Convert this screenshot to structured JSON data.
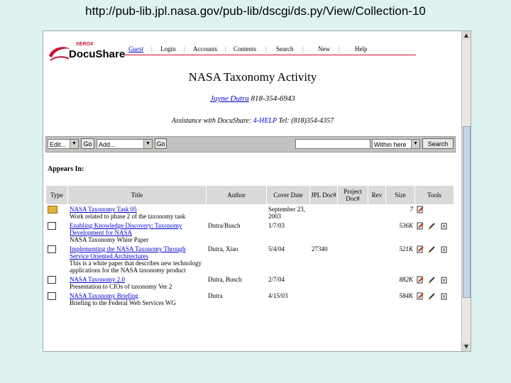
{
  "address_bar": {
    "url": "http://pub-lib.jpl.nasa.gov/pub-lib/dscgi/ds.py/View/Collection-10"
  },
  "logo": {
    "brand": "XEROX",
    "product": "DocuShare"
  },
  "nav": {
    "items": [
      "Guest",
      "Login",
      "Accounts",
      "Contents",
      "Search",
      "New",
      "Help"
    ]
  },
  "page": {
    "title": "NASA Taxonomy Activity",
    "contact_name": "Jayne Dutra",
    "contact_phone": "818-354-6943",
    "assist_label": "Assistance with DocuShare:",
    "assist_link": "4-HELP",
    "assist_tel": "Tel: (818)354-4357",
    "appears_in": "Appears In:"
  },
  "toolbar": {
    "edit_select": "Edit...",
    "go1": "Go",
    "add_select": "Add...",
    "go2": "Go",
    "scope_select": "Within here",
    "search_button": "Search"
  },
  "table": {
    "headers": [
      "Type",
      "Title",
      "Author",
      "Cover Date",
      "JPL Doc#",
      "Project Doc#",
      "Rev",
      "Size",
      "Tools"
    ],
    "rows": [
      {
        "type": "folder",
        "title": "NASA Taxonomy Task 05",
        "desc": "Work related to phase 2 of the taxonomy task",
        "author": "",
        "date": "September 23, 2003",
        "jpl": "",
        "proj": "",
        "rev": "",
        "size": "7"
      },
      {
        "type": "doc",
        "title": "Enabling Knowledge Discovery: Taxonomy Development for NASA",
        "desc": "NASA Taxonomy White Paper",
        "author": "Dutra/Busch",
        "date": "1/7/03",
        "jpl": "",
        "proj": "",
        "rev": "",
        "size": "536K"
      },
      {
        "type": "doc",
        "title": "Implementing the NASA Taxonomy Through Service Oriented Architectures",
        "desc": "This is a white paper that describes new technology applications for the NASA taxonomy product",
        "author": "Dutra, Xiao",
        "date": "5/4/04",
        "jpl": "27340",
        "proj": "",
        "rev": "",
        "size": "521K"
      },
      {
        "type": "doc",
        "title": "NASA Taxonomy 2.0",
        "desc": "Presentation to CIOs of taxonomy Ver 2",
        "author": "Dutra, Busch",
        "date": "2/7/04",
        "jpl": "",
        "proj": "",
        "rev": "",
        "size": "882K"
      },
      {
        "type": "doc",
        "title": "NASA Taxonomy Briefing",
        "desc": "Briefing to the Federal Web Services WG",
        "author": "Dutra",
        "date": "4/15/03",
        "jpl": "",
        "proj": "",
        "rev": "",
        "size": "584K"
      }
    ]
  },
  "colors": {
    "background": "#def3f1",
    "link": "#0000cc",
    "accent": "#c8102e"
  }
}
